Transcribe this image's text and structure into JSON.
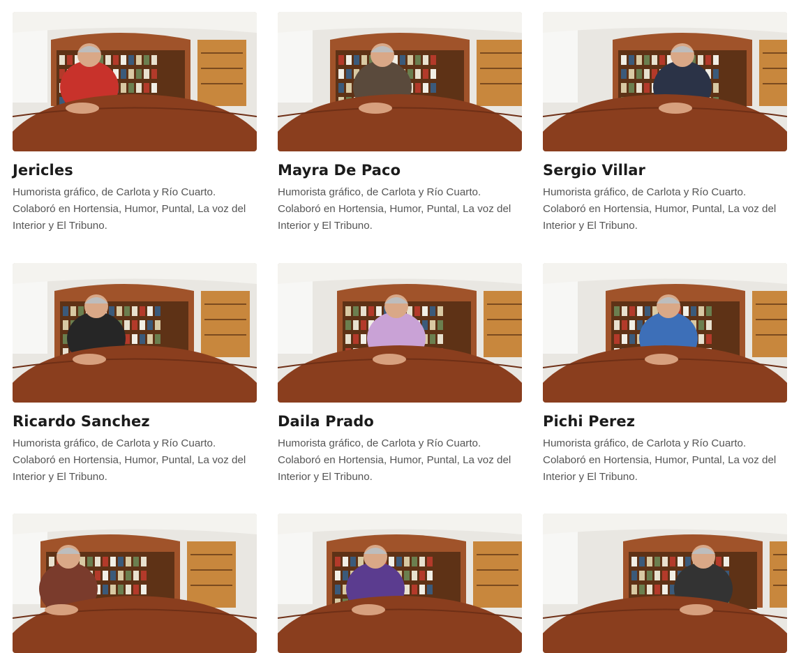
{
  "cards": [
    {
      "name": "Jericles",
      "description": "Humorista gráfico, de Carlota y Río Cuarto. Colaboró en Hortensia, Humor, Puntal, La voz del Interior y El Tribuno.",
      "image_alt": "Interview photo of Jericles",
      "shirt": "#c8322b"
    },
    {
      "name": "Mayra De Paco",
      "description": "Humorista gráfico, de Carlota y Río Cuarto. Colaboró en Hortensia, Humor, Puntal, La voz del Interior y El Tribuno.",
      "image_alt": "Interview photo of Mayra De Paco",
      "shirt": "#5a4a3c"
    },
    {
      "name": "Sergio Villar",
      "description": "Humorista gráfico, de Carlota y Río Cuarto. Colaboró en Hortensia, Humor, Puntal, La voz del Interior y El Tribuno.",
      "image_alt": "Interview photo of Sergio Villar",
      "shirt": "#2b3347"
    },
    {
      "name": "Ricardo Sanchez",
      "description": "Humorista gráfico, de Carlota y Río Cuarto. Colaboró en Hortensia, Humor, Puntal, La voz del Interior y El Tribuno.",
      "image_alt": "Interview photo of Ricardo Sanchez",
      "shirt": "#262626"
    },
    {
      "name": "Daila Prado",
      "description": "Humorista gráfico, de Carlota y Río Cuarto. Colaboró en Hortensia, Humor, Puntal, La voz del Interior y El Tribuno.",
      "image_alt": "Interview photo of Daila Prado",
      "shirt": "#c9a2d6"
    },
    {
      "name": "Pichi Perez",
      "description": "Humorista gráfico, de Carlota y Río Cuarto. Colaboró en Hortensia, Humor, Puntal, La voz del Interior y El Tribuno.",
      "image_alt": "Interview photo of Pichi Perez",
      "shirt": "#3d6fb8"
    },
    {
      "name": "",
      "description": "",
      "image_alt": "Interview photo",
      "shirt": "#7a3b2c"
    },
    {
      "name": "",
      "description": "",
      "image_alt": "Interview photo",
      "shirt": "#5b3c8f"
    },
    {
      "name": "",
      "description": "",
      "image_alt": "Interview photo",
      "shirt": "#333333"
    }
  ],
  "colors": {
    "wood": "#a0532a",
    "table": "#8a3e1e",
    "shelf": "#c8873d",
    "wall": "#e9e7e2",
    "title": "#1b1b1b",
    "text": "#555555"
  }
}
